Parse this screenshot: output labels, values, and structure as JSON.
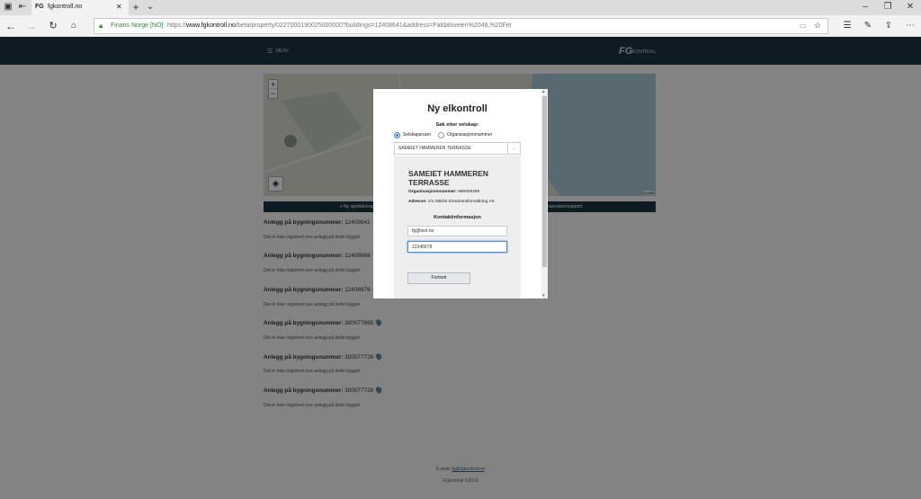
{
  "browser": {
    "tab_title": "fgkontroll.no",
    "site_identity": "Finans Norge [NO]",
    "url_prefix": "https://",
    "url_domain": "www.fgkontroll.no",
    "url_path": "/beta/property/0227000190025000000?buildings=12408641&address=Faldalsveien%2048,%20Fet"
  },
  "site": {
    "menu_label": "MENY",
    "logo_fg": "FG",
    "logo_text": "KONTROLL"
  },
  "map": {
    "zoom_in": "+",
    "zoom_out": "−",
    "attribution": "Leaflet"
  },
  "actions": {
    "left_button": "Ny sprinklerrapport",
    "right_button": "Ny brannalarmrapport"
  },
  "anlegg": [
    {
      "label": "Anlegg på bygningsnummer:",
      "number": "12408641",
      "pin_color": "#d9534f",
      "empty_text": "Det er ikke registrert noe anlegg på dette bygget."
    },
    {
      "label": "Anlegg på bygningsnummer:",
      "number": "12408668",
      "pin_color": "#5a8aa5",
      "empty_text": "Det er ikke registrert noe anlegg på dette bygget."
    },
    {
      "label": "Anlegg på bygningsnummer:",
      "number": "12408676",
      "pin_color": "#5a8aa5",
      "empty_text": "Det er ikke registrert noe anlegg på dette bygget."
    },
    {
      "label": "Anlegg på bygningsnummer:",
      "number": "300077695",
      "pin_color": "#5a8aa5",
      "empty_text": "Det er ikke registrert noe anlegg på dette bygget."
    },
    {
      "label": "Anlegg på bygningsnummer:",
      "number": "300077726",
      "pin_color": "#5a8aa5",
      "empty_text": "Det er ikke registrert noe anlegg på dette bygget."
    },
    {
      "label": "Anlegg på bygningsnummer:",
      "number": "300077728",
      "pin_color": "#5a8aa5",
      "empty_text": "Det er ikke registrert noe anlegg på dette bygget."
    }
  ],
  "footer": {
    "email_label": "E-post:",
    "email": "fg@fgkontroll.no",
    "copyright": "FGkontroll ©2019"
  },
  "modal": {
    "title": "Ny elkontroll",
    "search_label": "Søk etter selskap:",
    "radio_company": "Selskapsnavn",
    "radio_org": "Organisasjonsnummer",
    "selected_company": "SAMEIET HAMMEREN TERRASSE",
    "company_name_line1": "SAMEIET HAMMEREN",
    "company_name_line2": "TERRASSE",
    "org_label": "Organisasjonsnummer:",
    "org_value": "986608265",
    "address_label": "Adresse:",
    "address_value": "c/o OBOS Eiendomsforvaltning AS",
    "contact_heading": "Kontaktinformasjon",
    "email_value": "fg@test.no",
    "phone_value": "12345678",
    "continue_button": "Fortsett"
  },
  "colors": {
    "header_bg": "#1d3440",
    "ssl_green": "#2e8b3a"
  }
}
